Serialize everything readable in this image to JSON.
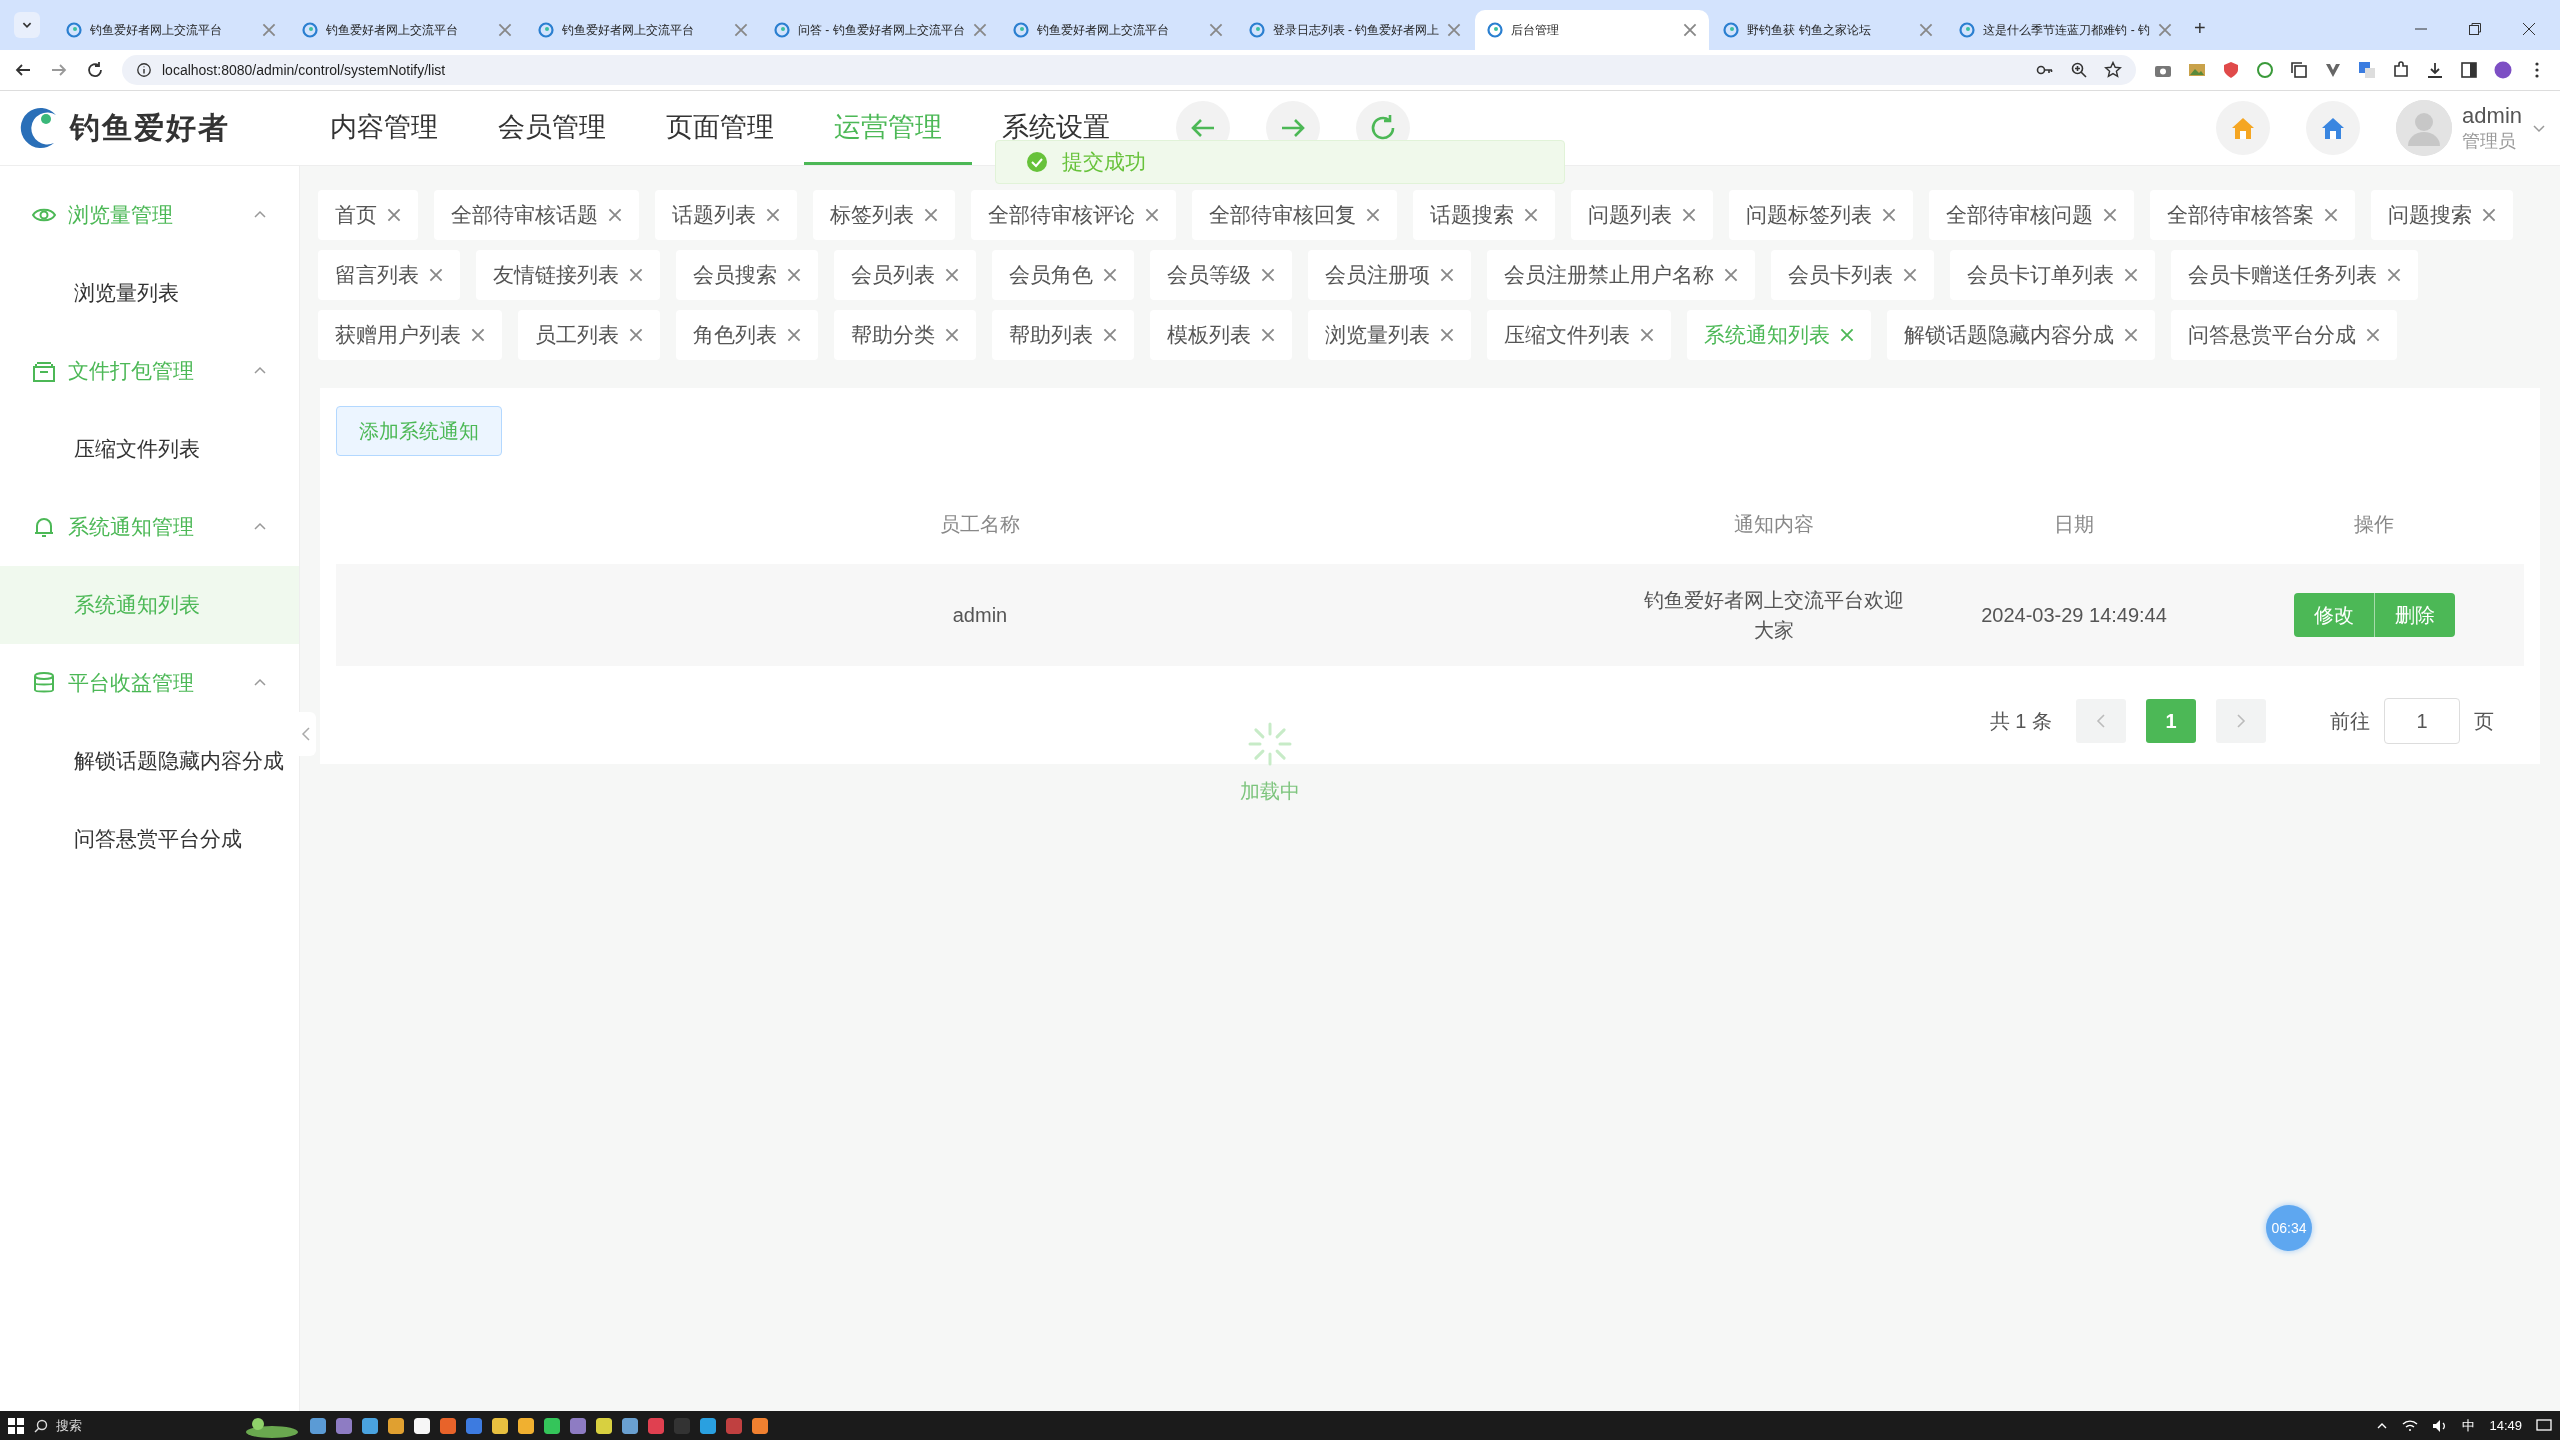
{
  "browser": {
    "tabs": [
      {
        "title": "钓鱼爱好者网上交流平台",
        "selected": false
      },
      {
        "title": "钓鱼爱好者网上交流平台",
        "selected": false
      },
      {
        "title": "钓鱼爱好者网上交流平台",
        "selected": false
      },
      {
        "title": "问答 - 钓鱼爱好者网上交流平台",
        "selected": false
      },
      {
        "title": "钓鱼爱好者网上交流平台",
        "selected": false
      },
      {
        "title": "登录日志列表 - 钓鱼爱好者网上",
        "selected": false
      },
      {
        "title": "后台管理",
        "selected": true
      },
      {
        "title": "野钓鱼获 钓鱼之家论坛",
        "selected": false
      },
      {
        "title": "这是什么季节连蓝刀都难钓 - 钓",
        "selected": false
      }
    ],
    "new_tab": "+",
    "url": "localhost:8080/admin/control/systemNotify/list"
  },
  "header": {
    "logo_text": "钓鱼爱好者",
    "nav": [
      {
        "label": "内容管理",
        "selected": false
      },
      {
        "label": "会员管理",
        "selected": false
      },
      {
        "label": "页面管理",
        "selected": false
      },
      {
        "label": "运营管理",
        "selected": true
      },
      {
        "label": "系统设置",
        "selected": false
      }
    ],
    "user": {
      "name": "admin",
      "role": "管理员"
    }
  },
  "sidebar": {
    "groups": [
      {
        "kind": "eye",
        "title": "浏览量管理",
        "expanded": true,
        "children": [
          {
            "label": "浏览量列表",
            "selected": false
          }
        ]
      },
      {
        "kind": "archive",
        "title": "文件打包管理",
        "expanded": true,
        "children": [
          {
            "label": "压缩文件列表",
            "selected": false
          }
        ]
      },
      {
        "kind": "bell",
        "title": "系统通知管理",
        "expanded": true,
        "children": [
          {
            "label": "系统通知列表",
            "selected": true
          }
        ]
      },
      {
        "kind": "database",
        "title": "平台收益管理",
        "expanded": true,
        "children": [
          {
            "label": "解锁话题隐藏内容分成",
            "selected": false
          },
          {
            "label": "问答悬赏平台分成",
            "selected": false
          }
        ]
      }
    ]
  },
  "tags": [
    {
      "label": "首页",
      "selected": false
    },
    {
      "label": "全部待审核话题",
      "selected": false
    },
    {
      "label": "话题列表",
      "selected": false
    },
    {
      "label": "标签列表",
      "selected": false
    },
    {
      "label": "全部待审核评论",
      "selected": false
    },
    {
      "label": "全部待审核回复",
      "selected": false
    },
    {
      "label": "话题搜索",
      "selected": false
    },
    {
      "label": "问题列表",
      "selected": false
    },
    {
      "label": "问题标签列表",
      "selected": false
    },
    {
      "label": "全部待审核问题",
      "selected": false
    },
    {
      "label": "全部待审核答案",
      "selected": false
    },
    {
      "label": "问题搜索",
      "selected": false
    },
    {
      "label": "留言列表",
      "selected": false
    },
    {
      "label": "友情链接列表",
      "selected": false
    },
    {
      "label": "会员搜索",
      "selected": false
    },
    {
      "label": "会员列表",
      "selected": false
    },
    {
      "label": "会员角色",
      "selected": false
    },
    {
      "label": "会员等级",
      "selected": false
    },
    {
      "label": "会员注册项",
      "selected": false
    },
    {
      "label": "会员注册禁止用户名称",
      "selected": false
    },
    {
      "label": "会员卡列表",
      "selected": false
    },
    {
      "label": "会员卡订单列表",
      "selected": false
    },
    {
      "label": "会员卡赠送任务列表",
      "selected": false
    },
    {
      "label": "获赠用户列表",
      "selected": false
    },
    {
      "label": "员工列表",
      "selected": false
    },
    {
      "label": "角色列表",
      "selected": false
    },
    {
      "label": "帮助分类",
      "selected": false
    },
    {
      "label": "帮助列表",
      "selected": false
    },
    {
      "label": "模板列表",
      "selected": false
    },
    {
      "label": "浏览量列表",
      "selected": false
    },
    {
      "label": "压缩文件列表",
      "selected": false
    },
    {
      "label": "系统通知列表",
      "selected": true
    },
    {
      "label": "解锁话题隐藏内容分成",
      "selected": false
    },
    {
      "label": "问答悬赏平台分成",
      "selected": false
    }
  ],
  "toast": {
    "message": "提交成功"
  },
  "add_button": "添加系统通知",
  "table": {
    "columns": [
      "员工名称",
      "通知内容",
      "日期",
      "操作"
    ],
    "rows": [
      {
        "cells": [
          "admin",
          "钓鱼爱好者网上交流平台欢迎大家",
          "2024-03-29 14:49:44"
        ],
        "actions": [
          "修改",
          "删除"
        ]
      }
    ]
  },
  "pagination": {
    "total": "共 1 条",
    "pages": [
      {
        "label": "1",
        "selected": true
      }
    ],
    "goto_label": "前往",
    "goto_value": "1",
    "page_suffix": "页"
  },
  "loading": {
    "text": "加载中"
  },
  "floating_badge": "06:34",
  "taskbar": {
    "search_placeholder": "搜索",
    "ime": "中",
    "time": "14:49"
  }
}
